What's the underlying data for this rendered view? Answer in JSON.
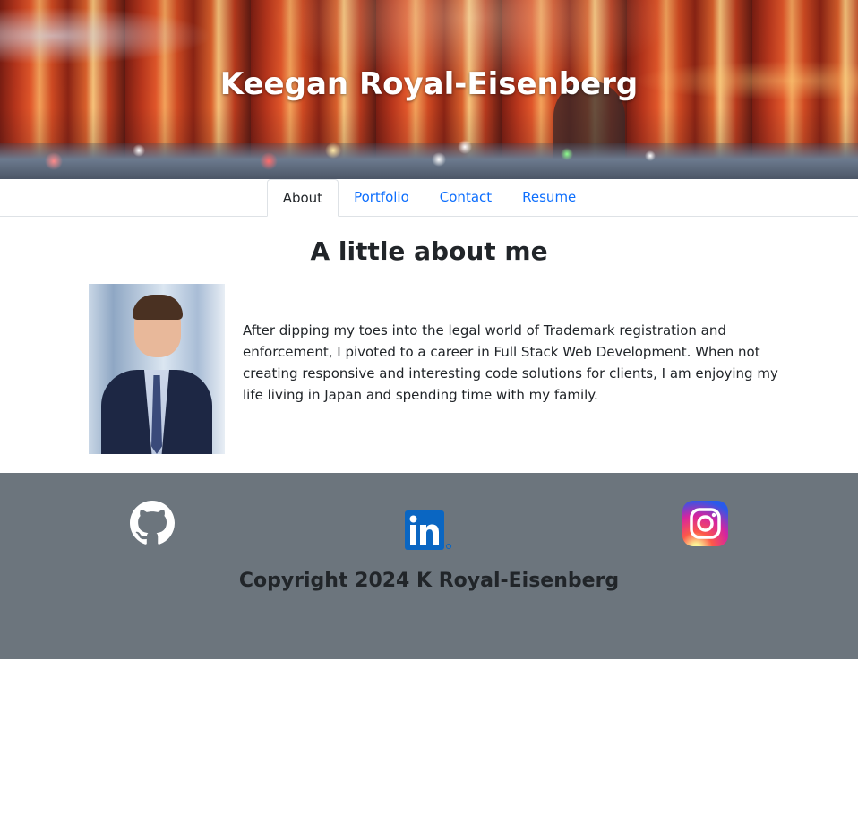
{
  "header": {
    "title": "Keegan Royal-Eisenberg"
  },
  "nav": {
    "tabs": [
      {
        "label": "About",
        "active": true
      },
      {
        "label": "Portfolio",
        "active": false
      },
      {
        "label": "Contact",
        "active": false
      },
      {
        "label": "Resume",
        "active": false
      }
    ]
  },
  "about": {
    "heading": "A little about me",
    "text": "After dipping my toes into the legal world of Trademark registration and enforcement, I pivoted to a career in Full Stack Web Development. When not creating responsive and interesting code solutions for clients, I am enjoying my life living in Japan and spending time with my family."
  },
  "footer": {
    "icons": [
      "github-icon",
      "linkedin-icon",
      "instagram-icon"
    ],
    "copyright": "Copyright 2024 K Royal-Eisenberg"
  },
  "colors": {
    "link": "#0d6efd",
    "footer_bg": "#6c757d",
    "text": "#212529",
    "linkedin_blue": "#0a66c2"
  }
}
